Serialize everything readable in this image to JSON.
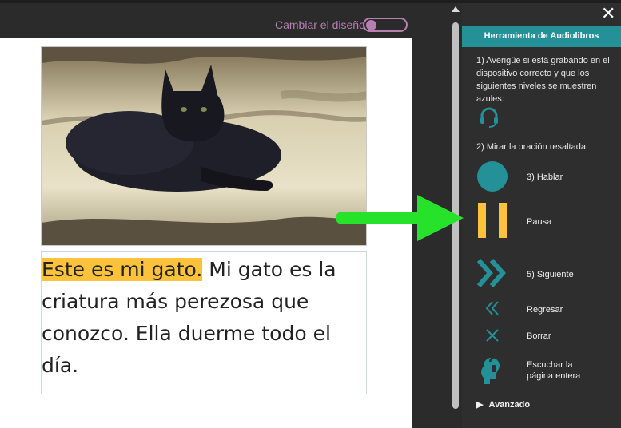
{
  "editor": {
    "layout_toggle_label": "Cambiar el diseño"
  },
  "story": {
    "highlighted_sentence": "Este es mi gato.",
    "rest_text": " Mi gato es la criatura más perezosa que conozco. Ella duerme todo el día."
  },
  "panel": {
    "close_label": "✕",
    "title": "Herramienta de Audiolibros",
    "step1": "1) Averigüe si está grabando en el dispositivo correcto y que los siguientes niveles se muestren azules:",
    "step2": "2) Mirar la oración resaltada",
    "speak_label": "3) Hablar",
    "pause_label": "Pausa",
    "next_label": "5) Siguiente",
    "back_label": "Regresar",
    "clear_label": "Borrar",
    "listen_label_1": "Escuchar la",
    "listen_label_2": "página entera",
    "advanced_label": "Avanzado",
    "advanced_arrow": "▶"
  },
  "colors": {
    "accent": "#239197",
    "pause": "#fcc23c",
    "highlight": "#fcc23c",
    "arrow": "#27e22b",
    "toggle": "#b77eb0"
  },
  "icons": [
    "headset-icon",
    "record-icon",
    "pause-icon",
    "next-icon",
    "back-icon",
    "clear-icon",
    "listen-page-icon",
    "arrow-annotation-icon"
  ]
}
